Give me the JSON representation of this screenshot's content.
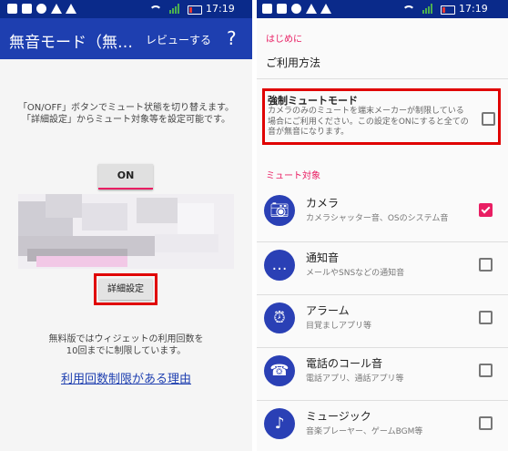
{
  "status": {
    "time": "17:19"
  },
  "left": {
    "title": "無音モード（無…",
    "review": "レビューする",
    "help": "?",
    "desc_lines": [
      "「ON/OFF」ボタンでミュート状態を切り替えます。",
      "「詳細設定」からミュート対象等を設定可能です。"
    ],
    "on_button": "ON",
    "detail_button": "詳細設定",
    "limit_lines": [
      "無料版ではウィジェットの利用回数を",
      "10回までに制限しています。"
    ],
    "limit_link": "利用回数制限がある理由"
  },
  "right": {
    "intro_header": "はじめに",
    "usage": "ご利用方法",
    "force": {
      "title": "強制ミュートモード",
      "desc": "カメラのみのミュートを端末メーカーが制限している場合にご利用ください。この設定をONにすると全ての音が無音になります。",
      "checked": false
    },
    "targets_header": "ミュート対象",
    "items": [
      {
        "title": "カメラ",
        "sub": "カメラシャッター音、OSのシステム音",
        "icon": "camera-icon",
        "checked": true
      },
      {
        "title": "通知音",
        "sub": "メールやSNSなどの通知音",
        "icon": "chat-bubble-icon",
        "checked": false
      },
      {
        "title": "アラーム",
        "sub": "目覚ましアプリ等",
        "icon": "alarm-clock-icon",
        "checked": false
      },
      {
        "title": "電話のコール音",
        "sub": "電話アプリ、通話アプリ等",
        "icon": "phone-ring-icon",
        "checked": false
      },
      {
        "title": "ミュージック",
        "sub": "音楽プレーヤー、ゲームBGM等",
        "icon": "music-note-icon",
        "checked": false
      }
    ]
  },
  "colors": {
    "statusbar": "#0a2a8a",
    "appbar": "#1e3fb0",
    "accent": "#e91e63",
    "highlight": "#e00000",
    "icon_bg": "#2a40b5"
  }
}
